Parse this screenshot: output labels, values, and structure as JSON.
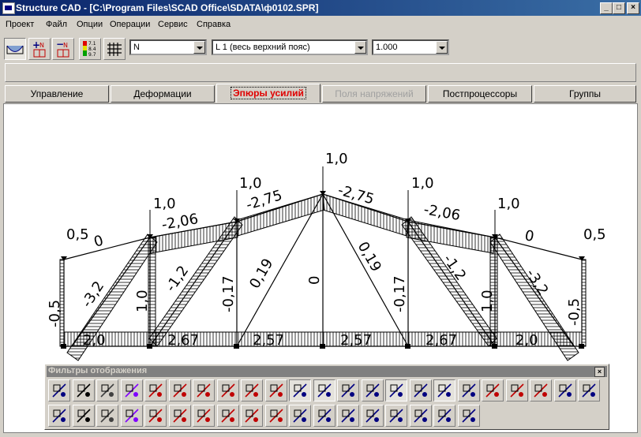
{
  "window": {
    "title": "Structure CAD  - [C:\\Program Files\\SCAD Office\\SDATA\\ф0102.SPR]"
  },
  "menu": [
    "Проект",
    "Файл",
    "Опции",
    "Операции",
    "Сервис",
    "Справка"
  ],
  "toolbar": {
    "factor_combo": "N",
    "load_combo": "L 1 (весь верхний пояс)",
    "scale_combo": "1.000",
    "buttons": [
      "diagram-icon",
      "add-n-icon",
      "remove-n-icon",
      "value-labels-icon",
      "grid-icon"
    ]
  },
  "tabs": [
    {
      "label": "Управление",
      "state": "normal"
    },
    {
      "label": "Деформации",
      "state": "normal"
    },
    {
      "label": "Эпюры усилий",
      "state": "active"
    },
    {
      "label": "Поля напряжений",
      "state": "disabled"
    },
    {
      "label": "Постпроцессоры",
      "state": "normal"
    },
    {
      "label": "Группы",
      "state": "normal"
    }
  ],
  "diagram": {
    "top_chord_values": [
      "0",
      "-2,06",
      "-2,75",
      "-2,75",
      "-2,06",
      "0"
    ],
    "post_top_values": [
      "0,5",
      "1,0",
      "1,0",
      "1,0",
      "1,0",
      "1,0",
      "0,5"
    ],
    "vertical_values": [
      "-0,5",
      "1,0",
      "-0,17",
      "0",
      "-0,17",
      "1,0",
      "-0,5"
    ],
    "diagonal_values": [
      "-3,2",
      "-1,2",
      "0,19",
      "0,19",
      "-1,2",
      "-3,2"
    ],
    "bottom_chord_values": [
      "2,0",
      "2,67",
      "2,57",
      "2,57",
      "2,67",
      "2,0"
    ],
    "colors": {
      "structure": "#000000",
      "hatch": "#000000",
      "background": "#ffffff"
    }
  },
  "filters": {
    "title": "Фильтры отображения",
    "row1_icons": [
      "pencil-icon",
      "eraser-icon",
      "box-icon",
      "spring-icon",
      "node-numbers-icon",
      "element-numbers-icon",
      "n-labels-icon",
      "nj-labels-icon",
      "type-labels-icon",
      "rigidity-icon",
      "supports-icon",
      "hinges-icon",
      "local-axes-icon",
      "axes-icon",
      "slabs-icon",
      "offsets-icon",
      "loads-icon",
      "load-values-icon",
      "force-icon",
      "force-values-icon",
      "moment-icon",
      "node-cross-icon",
      "fragment-icon"
    ],
    "row2_icons": [
      "restore-icon",
      "grid-elements-icon",
      "mesh-icon",
      "eraser2-icon",
      "section-icon",
      "colored-icon",
      "brush-icon",
      "layers-icon",
      "groups-icon",
      "n-group-icon",
      "g-group-icon",
      "ge-group-icon",
      "g2-group-icon",
      "table-icon",
      "red-grid-icon",
      "steel-icon",
      "stamp-icon",
      "color-scale-icon"
    ]
  }
}
